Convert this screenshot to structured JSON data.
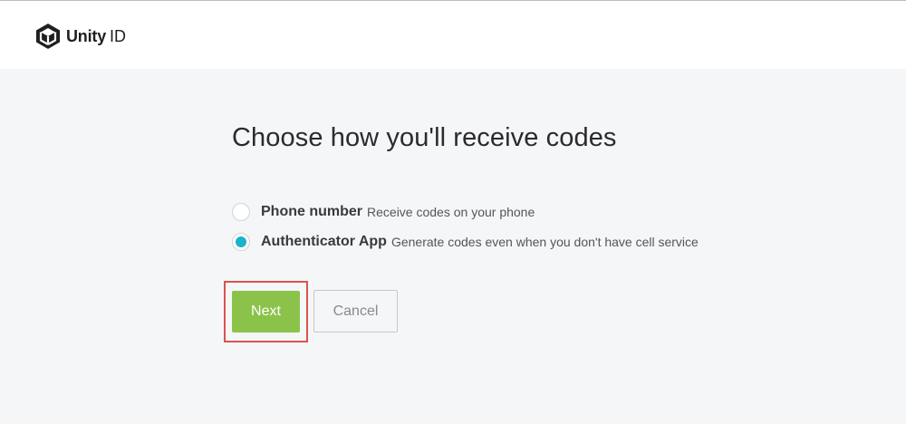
{
  "header": {
    "logo_icon": "unity-cube-icon",
    "brand": "Unity",
    "product": "ID"
  },
  "main": {
    "title": "Choose how you'll receive codes",
    "options": [
      {
        "label": "Phone number",
        "description": "Receive codes on your phone",
        "selected": false
      },
      {
        "label": "Authenticator App",
        "description": "Generate codes even when you don't have cell service",
        "selected": true
      }
    ],
    "next_label": "Next",
    "cancel_label": "Cancel"
  },
  "colors": {
    "accent_green": "#8bc34a",
    "radio_selected": "#1ab3c9",
    "highlight_outline": "#d9534f",
    "page_background": "#f5f6f8"
  }
}
